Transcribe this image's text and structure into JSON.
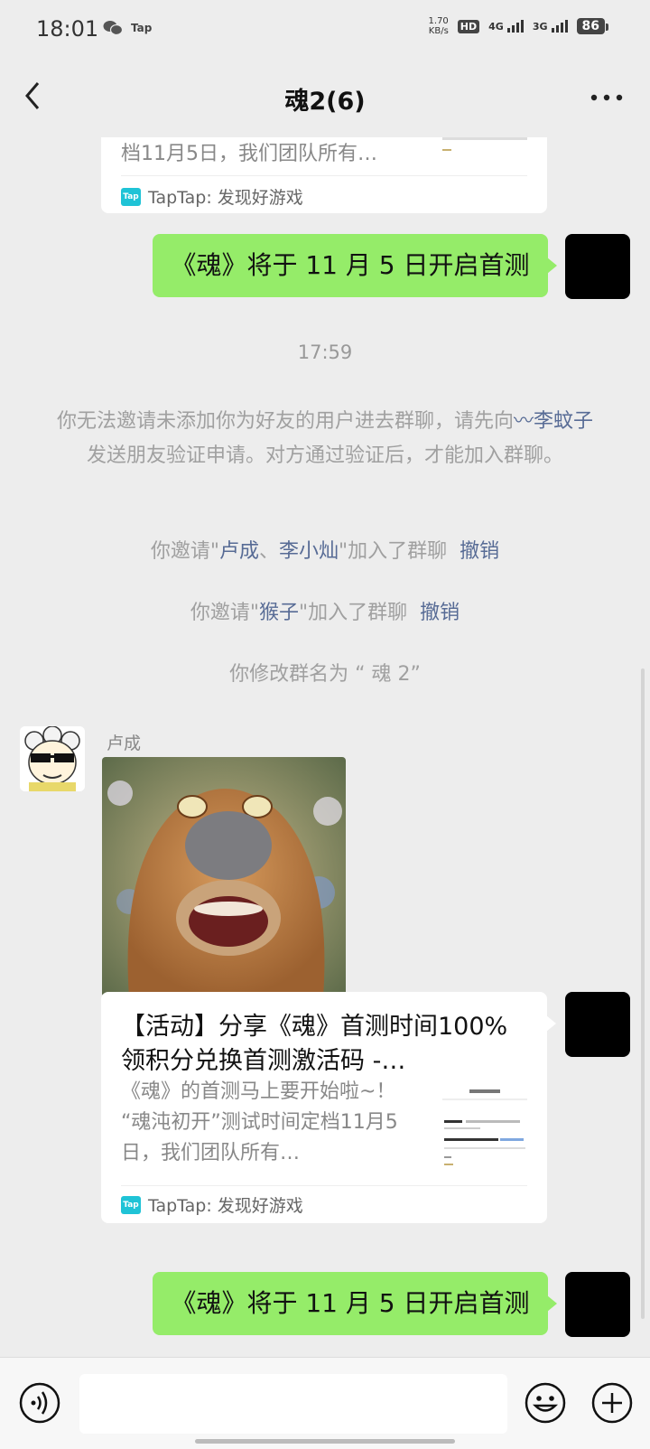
{
  "status_bar": {
    "time": "18:01",
    "app_label": "Tap",
    "speed_value": "1.70",
    "speed_unit": "KB/s",
    "hd_label": "HD",
    "sim1_label": "4G",
    "sim2_label": "3G",
    "battery": "86"
  },
  "header": {
    "title": "魂2(6)"
  },
  "messages": {
    "card_top": {
      "desc_tail": "档11月5日，我们团队所有…",
      "source": "TapTap: 发现好游戏"
    },
    "bubble1": "《魂》将于 11 月 5 日开启首测",
    "timestamp": "17:59",
    "system_notice": {
      "part1": "你无法邀请未添加你为好友的用户进去群聊，请先向",
      "name": "李蚊子",
      "part2": "发送朋友验证申请。对方通过验证后，才能加入群聊。"
    },
    "invite1": {
      "prefix": "你邀请\"",
      "name1": "卢成",
      "sep": "、",
      "name2": "李小灿",
      "suffix": "\"加入了群聊",
      "action": "撤销"
    },
    "invite2": {
      "prefix": "你邀请\"",
      "name": "猴子",
      "suffix": "\"加入了群聊",
      "action": "撤销"
    },
    "rename": "你修改群名为 “ 魂 2”",
    "sender_name": "卢成",
    "card": {
      "title": "【活动】分享《魂》首测时间100%领积分兑换首测激活码 -…",
      "desc": "《魂》的首测马上要开始啦~！ “魂沌初开”测试时间定档11月5日，我们团队所有…",
      "source": "TapTap: 发现好游戏"
    },
    "bubble2": "《魂》将于 11 月 5 日开启首测"
  },
  "colors": {
    "bubble_green": "#95ec69",
    "link_blue": "#576b95",
    "background": "#ededed",
    "taptap_teal": "#1fc3d6"
  },
  "icons": [
    "back-arrow-icon",
    "more-icon",
    "voice-icon",
    "emoji-icon",
    "plus-icon"
  ]
}
